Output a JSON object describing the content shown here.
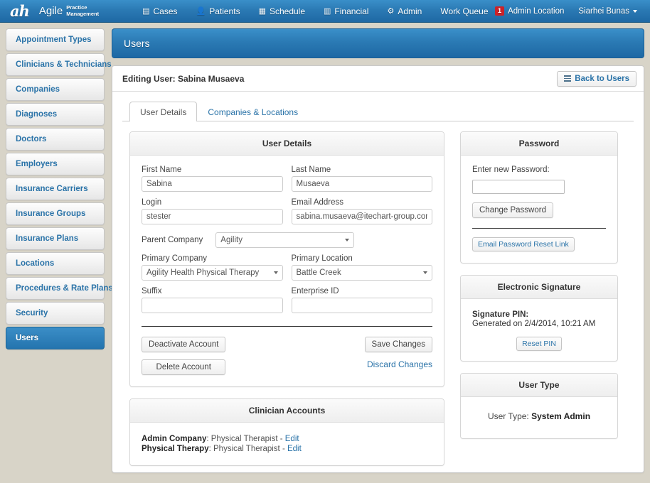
{
  "navbar": {
    "logo_mark": "ah",
    "brand_name": "Agile",
    "brand_sub_line1": "Practice",
    "brand_sub_line2": "Management",
    "links": [
      {
        "label": "Cases",
        "icon": "cases-icon",
        "glyph": "▤"
      },
      {
        "label": "Patients",
        "icon": "patients-icon",
        "glyph": "☰"
      },
      {
        "label": "Schedule",
        "icon": "schedule-icon",
        "glyph": "▦"
      },
      {
        "label": "Financial",
        "icon": "financial-icon",
        "glyph": "▥"
      },
      {
        "label": "Admin",
        "icon": "admin-icon",
        "glyph": "⚙"
      },
      {
        "label": "Work Queue",
        "icon": "",
        "glyph": ""
      }
    ],
    "badge_count": "1",
    "location_label": "Admin Location",
    "user_name": "Siarhei Bunas"
  },
  "sidebar": {
    "items": [
      {
        "label": "Appointment Types",
        "active": false
      },
      {
        "label": "Clinicians & Technicians",
        "active": false
      },
      {
        "label": "Companies",
        "active": false
      },
      {
        "label": "Diagnoses",
        "active": false
      },
      {
        "label": "Doctors",
        "active": false
      },
      {
        "label": "Employers",
        "active": false
      },
      {
        "label": "Insurance Carriers",
        "active": false
      },
      {
        "label": "Insurance Groups",
        "active": false
      },
      {
        "label": "Insurance Plans",
        "active": false
      },
      {
        "label": "Locations",
        "active": false
      },
      {
        "label": "Procedures & Rate Plans",
        "active": false
      },
      {
        "label": "Security",
        "active": false
      },
      {
        "label": "Users",
        "active": true
      }
    ]
  },
  "page": {
    "title": "Users",
    "editing_label": "Editing User: Sabina Musaeva",
    "back_button": "Back to Users"
  },
  "tabs": [
    {
      "label": "User Details",
      "active": true
    },
    {
      "label": "Companies & Locations",
      "active": false
    }
  ],
  "user_details": {
    "panel_title": "User Details",
    "fields": {
      "first_name_label": "First Name",
      "first_name_value": "Sabina",
      "last_name_label": "Last Name",
      "last_name_value": "Musaeva",
      "login_label": "Login",
      "login_value": "stester",
      "email_label": "Email Address",
      "email_value": "sabina.musaeva@itechart-group.com",
      "parent_company_label": "Parent Company",
      "parent_company_value": "Agility",
      "primary_company_label": "Primary Company",
      "primary_company_value": "Agility Health Physical Therapy",
      "primary_location_label": "Primary Location",
      "primary_location_value": "Battle Creek",
      "suffix_label": "Suffix",
      "suffix_value": "",
      "enterprise_id_label": "Enterprise ID",
      "enterprise_id_value": ""
    },
    "actions": {
      "deactivate": "Deactivate Account",
      "delete": "Delete Account",
      "save": "Save Changes",
      "discard": "Discard Changes"
    }
  },
  "password": {
    "panel_title": "Password",
    "label": "Enter new Password:",
    "value": "",
    "change_button": "Change Password",
    "email_reset_button": "Email Password Reset Link"
  },
  "signature": {
    "panel_title": "Electronic Signature",
    "pin_label": "Signature PIN:",
    "generated_text": "Generated on 2/4/2014, 10:21 AM",
    "reset_button": "Reset PIN"
  },
  "user_type": {
    "panel_title": "User Type",
    "label": "User Type:",
    "value": "System Admin"
  },
  "clinician_accounts": {
    "panel_title": "Clinician Accounts",
    "rows": [
      {
        "company": "Admin Company",
        "role": "Physical Therapist",
        "edit": "Edit"
      },
      {
        "company": "Physical Therapy",
        "role": "Physical Therapist",
        "edit": "Edit"
      }
    ]
  },
  "colors": {
    "brand_blue": "#2b7ab4",
    "link_blue": "#2a73a8",
    "page_bg": "#d8d4c8",
    "badge_red": "#cb2229"
  }
}
